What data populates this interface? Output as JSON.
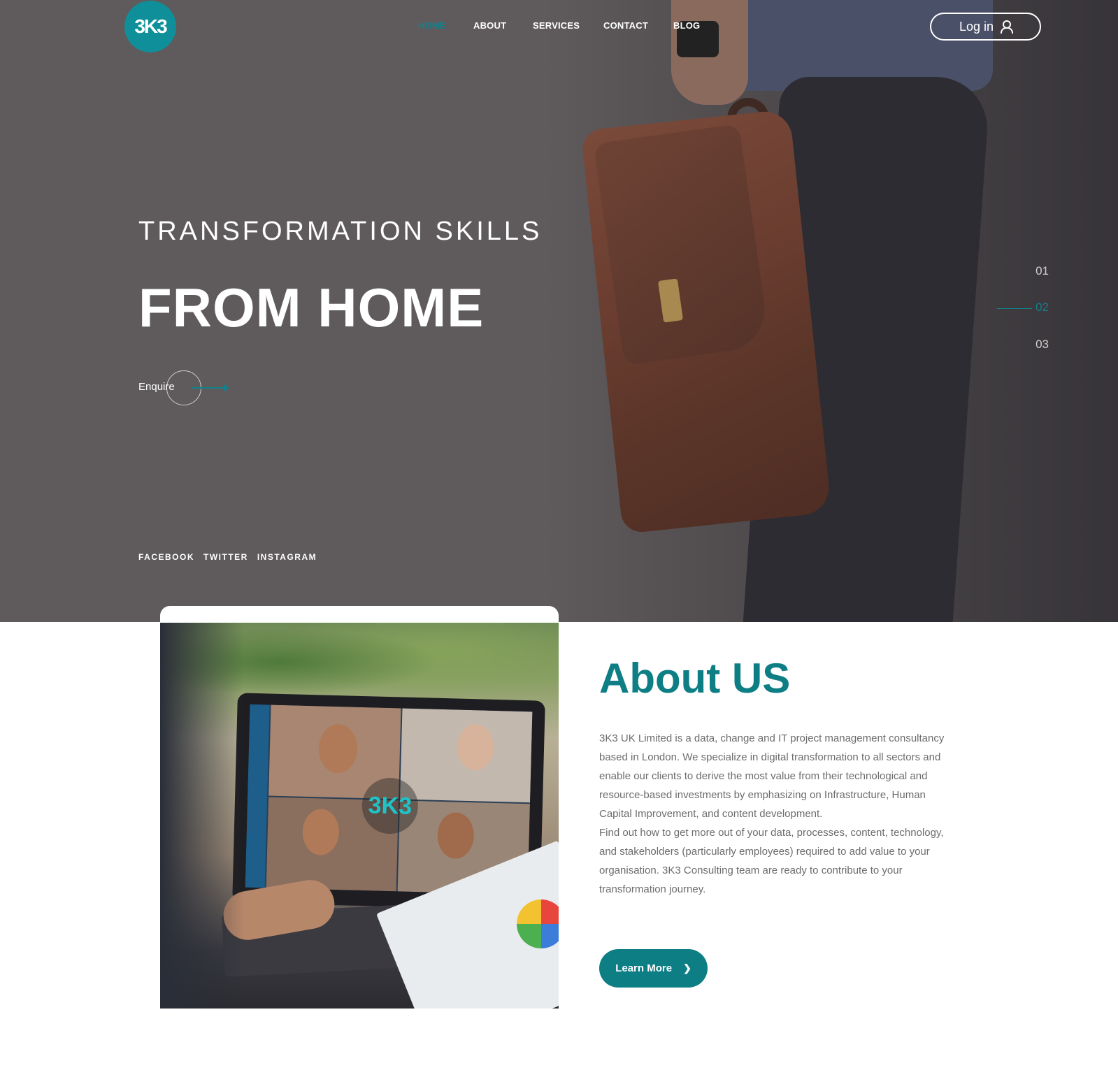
{
  "brand": {
    "logo_text": "3K3",
    "accent_color": "#0e7e85"
  },
  "nav": {
    "items": [
      {
        "label": "HOME",
        "active": true
      },
      {
        "label": "ABOUT",
        "active": false
      },
      {
        "label": "SERVICES",
        "active": false
      },
      {
        "label": "CONTACT",
        "active": false
      },
      {
        "label": "BLOG",
        "active": false
      }
    ],
    "login_label": "Log in",
    "login_icon": "user-icon"
  },
  "hero": {
    "eyebrow": "TRANSFORMATION SKILLS",
    "title": "FROM HOME",
    "cta_label": "Enquire",
    "cta_icon": "arrow-right-icon",
    "slides": [
      "01",
      "02",
      "03"
    ],
    "active_slide": "02",
    "socials": [
      "FACEBOOK",
      "TWITTER",
      "INSTAGRAM"
    ]
  },
  "about": {
    "title": "About US",
    "paragraph_1": "3K3 UK Limited is a data, change and IT project management consultancy based in London. We specialize in digital transformation to all sectors and enable our clients to derive the most value from their technological and resource-based investments by emphasizing on Infrastructure, Human Capital Improvement, and content development.",
    "paragraph_2": "Find out how to get more out of your data, processes, content, technology, and stakeholders (particularly employees) required to add value to your organisation. 3K3 Consulting team are ready to contribute to your transformation journey.",
    "button_label": "Learn More",
    "button_icon": "chevron-right-icon"
  }
}
